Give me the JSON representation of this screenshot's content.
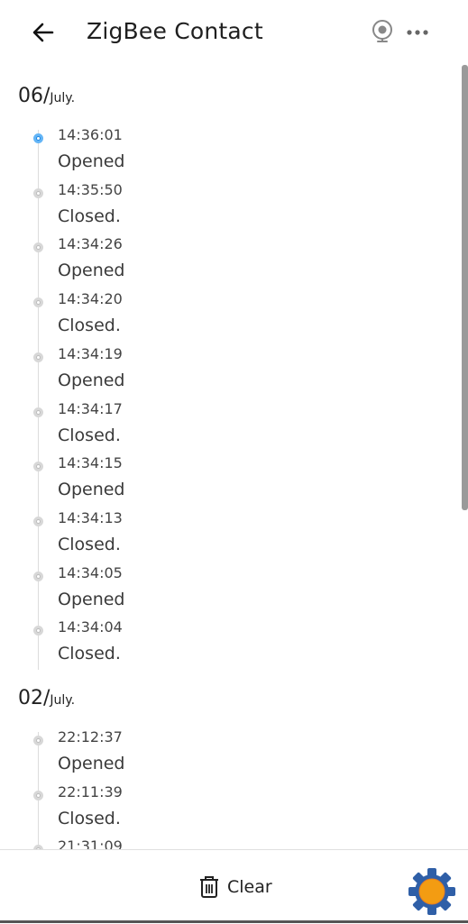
{
  "header": {
    "title": "ZigBee Contact",
    "back_icon": "arrow-left-icon",
    "camera_icon": "webcam-icon",
    "more_icon": "more-horizontal-icon"
  },
  "groups": [
    {
      "day": "06/",
      "month": "July.",
      "events": [
        {
          "time": "14:36:01",
          "state": "Opened",
          "active": true
        },
        {
          "time": "14:35:50",
          "state": "Closed.",
          "active": false
        },
        {
          "time": "14:34:26",
          "state": "Opened",
          "active": false
        },
        {
          "time": "14:34:20",
          "state": "Closed.",
          "active": false
        },
        {
          "time": "14:34:19",
          "state": "Opened",
          "active": false
        },
        {
          "time": "14:34:17",
          "state": "Closed.",
          "active": false
        },
        {
          "time": "14:34:15",
          "state": "Opened",
          "active": false
        },
        {
          "time": "14:34:13",
          "state": "Closed.",
          "active": false
        },
        {
          "time": "14:34:05",
          "state": "Opened",
          "active": false
        },
        {
          "time": "14:34:04",
          "state": "Closed.",
          "active": false
        }
      ]
    },
    {
      "day": "02/",
      "month": "July.",
      "events": [
        {
          "time": "22:12:37",
          "state": "Opened",
          "active": false
        },
        {
          "time": "22:11:39",
          "state": "Closed.",
          "active": false
        },
        {
          "time": "21:31:09",
          "state": "",
          "active": false
        }
      ]
    }
  ],
  "footer": {
    "clear_label": "Clear",
    "clear_icon": "trash-icon",
    "settings_icon": "gear-icon"
  },
  "colors": {
    "accent": "#1e88e5",
    "dot_inactive": "#bdbdbd",
    "gear_fill": "#f39c12",
    "gear_ring": "#2f5fa7"
  }
}
